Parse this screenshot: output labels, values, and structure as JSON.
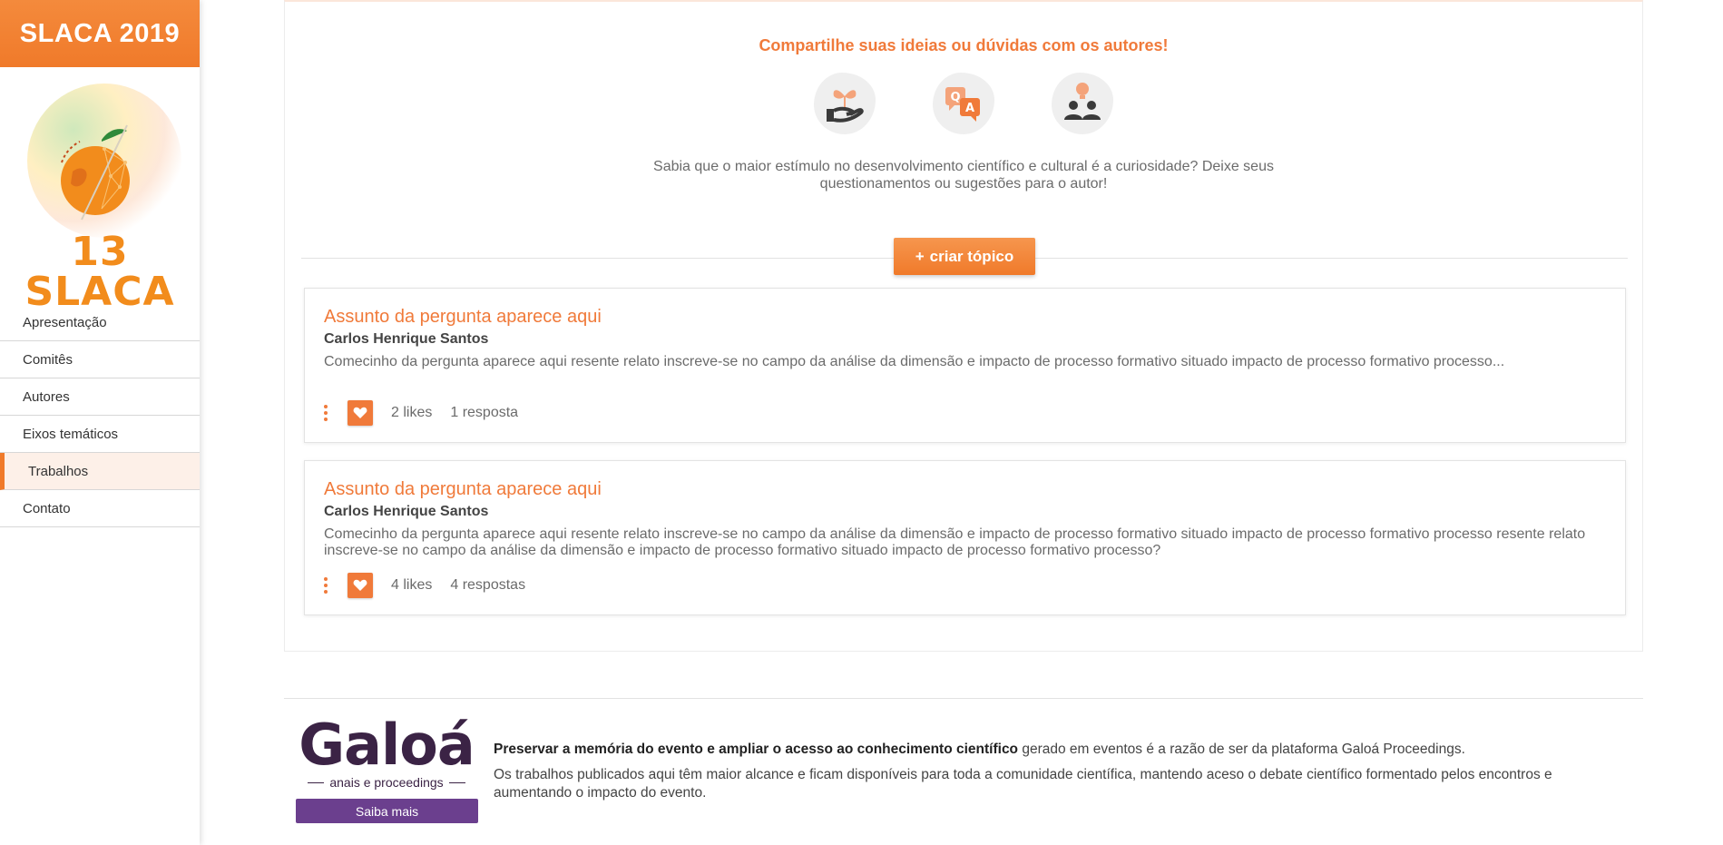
{
  "sidebar": {
    "brand": "SLACA 2019",
    "logo_text": "13 SLACA",
    "items": [
      {
        "label": "Apresentação"
      },
      {
        "label": "Comitês"
      },
      {
        "label": "Autores"
      },
      {
        "label": "Eixos temáticos"
      },
      {
        "label": "Trabalhos",
        "active": true
      },
      {
        "label": "Contato"
      }
    ]
  },
  "main": {
    "share_title": "Compartilhe suas ideias ou dúvidas com os autores!",
    "icons": [
      "plant-hand-icon",
      "qa-icon",
      "people-idea-icon"
    ],
    "description_line1": "Sabia que o maior estímulo no desenvolvimento científico e cultural é a curiosidade? Deixe seus",
    "description_line2": "questionamentos ou sugestões para o autor!",
    "create_button": "criar tópico",
    "topics": [
      {
        "title": "Assunto da pergunta aparece aqui",
        "author": "Carlos Henrique Santos",
        "body": "Comecinho da pergunta aparece aqui resente relato inscreve-se no campo da análise da dimensão e impacto de processo formativo situado impacto de processo formativo processo...",
        "likes": "2 likes",
        "replies": "1 resposta"
      },
      {
        "title": "Assunto da pergunta aparece aqui",
        "author": "Carlos Henrique Santos",
        "body": "Comecinho da pergunta aparece aqui resente relato inscreve-se no campo da análise da dimensão e impacto de processo formativo situado impacto de processo formativo processo resente relato inscreve-se no campo da análise da dimensão e impacto de processo formativo situado impacto de processo formativo processo?",
        "likes": "4 likes",
        "replies": "4 respostas"
      }
    ]
  },
  "footer": {
    "logo_word": "Galoá",
    "logo_sub": "anais e proceedings",
    "saiba_button": "Saiba mais",
    "para1_bold": "Preservar a memória do evento e ampliar o acesso ao conhecimento científico",
    "para1_rest": " gerado em eventos é a razão de ser da plataforma Galoá Proceedings.",
    "para2": "Os trabalhos publicados aqui têm maior alcance e ficam disponíveis para toda a comunidade científica, mantendo aceso o debate científico formentado pelos encontros e aumentando o impacto do evento."
  },
  "colors": {
    "accent": "#f07a3a",
    "brand_orange": "#f28c1c",
    "galoa_purple": "#3b2345",
    "saiba_purple": "#6b3f8e"
  }
}
